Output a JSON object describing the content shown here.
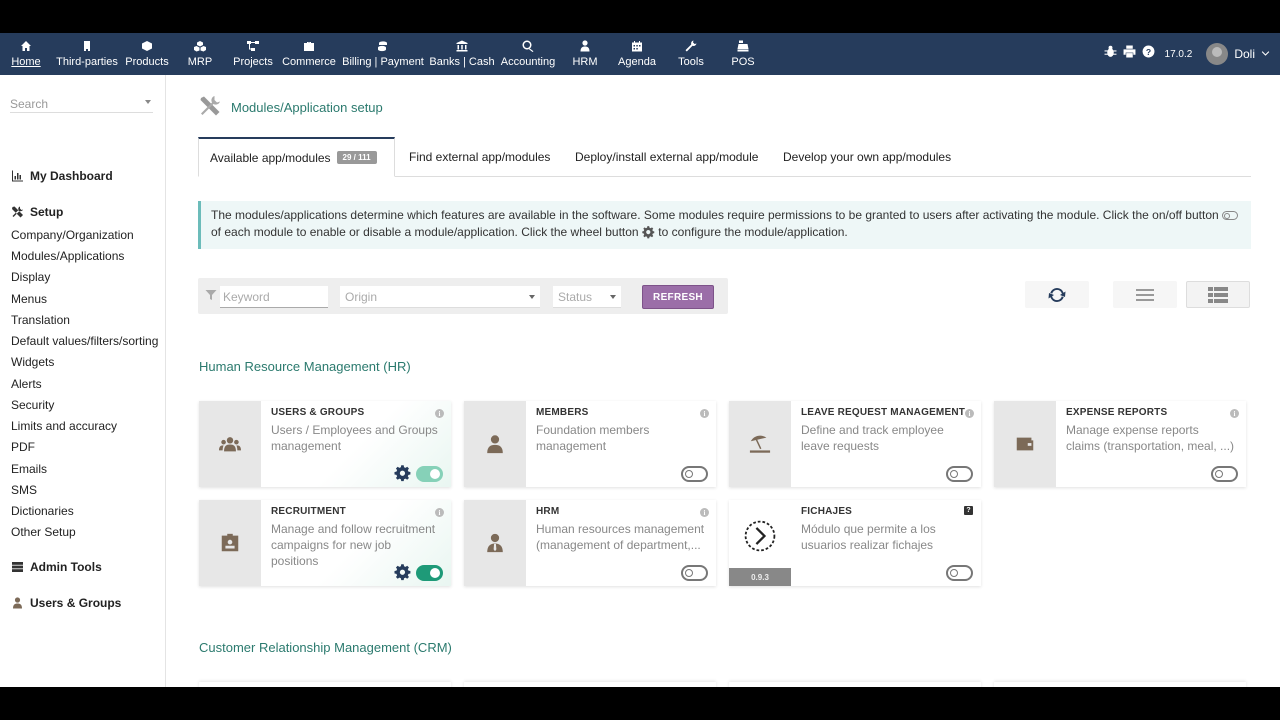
{
  "topbar": {
    "menus": [
      {
        "label": "Home",
        "icon": "home-icon"
      },
      {
        "label": "Third-parties",
        "icon": "building-icon"
      },
      {
        "label": "Products",
        "icon": "cube-icon"
      },
      {
        "label": "MRP",
        "icon": "cubes-icon"
      },
      {
        "label": "Projects",
        "icon": "project-diagram-icon"
      },
      {
        "label": "Commerce",
        "icon": "suitcase-icon"
      },
      {
        "label": "Billing | Payment",
        "icon": "coins-icon"
      },
      {
        "label": "Banks | Cash",
        "icon": "university-icon"
      },
      {
        "label": "Accounting",
        "icon": "search-dollar-icon"
      },
      {
        "label": "HRM",
        "icon": "user-tie-icon"
      },
      {
        "label": "Agenda",
        "icon": "calendar-icon"
      },
      {
        "label": "Tools",
        "icon": "wrench-icon"
      },
      {
        "label": "POS",
        "icon": "cash-register-icon"
      }
    ],
    "version": "17.0.2",
    "username": "Doli"
  },
  "sidebar": {
    "search_placeholder": "Search",
    "my_dashboard": "My Dashboard",
    "setup": "Setup",
    "setup_items": [
      "Company/Organization",
      "Modules/Applications",
      "Display",
      "Menus",
      "Translation",
      "Default values/filters/sorting",
      "Widgets",
      "Alerts",
      "Security",
      "Limits and accuracy",
      "PDF",
      "Emails",
      "SMS",
      "Dictionaries",
      "Other Setup"
    ],
    "admin_tools": "Admin Tools",
    "users_groups": "Users & Groups"
  },
  "main": {
    "title": "Modules/Application setup",
    "tabs": [
      {
        "label": "Available app/modules",
        "badge": "29 / 111"
      },
      {
        "label": "Find external app/modules"
      },
      {
        "label": "Deploy/install external app/module"
      },
      {
        "label": "Develop your own app/modules"
      }
    ],
    "info_part1": "The modules/applications determine which features are available in the software. Some modules require permissions to be granted to users after activating the module. Click the on/off button",
    "info_part2": "of each module to enable or disable a module/application. Click the wheel button",
    "info_part3": "to configure the module/application.",
    "filter": {
      "keyword_placeholder": "Keyword",
      "origin_placeholder": "Origin",
      "status_placeholder": "Status",
      "refresh_label": "REFRESH"
    },
    "sections": [
      {
        "title": "Human Resource Management (HR)",
        "modules": [
          {
            "title": "USERS & GROUPS",
            "desc": "Users / Employees and Groups management",
            "enabled": true,
            "icon": "users-icon"
          },
          {
            "title": "MEMBERS",
            "desc": "Foundation members management",
            "enabled": false,
            "icon": "user-icon"
          },
          {
            "title": "LEAVE REQUEST MANAGEMENT",
            "desc": "Define and track employee leave requests",
            "enabled": false,
            "icon": "umbrella-beach-icon"
          },
          {
            "title": "EXPENSE REPORTS",
            "desc": "Manage expense reports claims (transportation, meal, ...)",
            "enabled": false,
            "icon": "wallet-icon"
          },
          {
            "title": "RECRUITMENT",
            "desc": "Manage and follow recruitment campaigns for new job positions",
            "enabled": true,
            "icon": "id-badge-icon"
          },
          {
            "title": "HRM",
            "desc": "Human resources management (management of department,...",
            "enabled": false,
            "icon": "user-tie-icon"
          },
          {
            "title": "FICHAJES",
            "desc": "Módulo que permite a los usuarios realizar fichajes",
            "enabled": false,
            "icon": "clock-arrow-icon",
            "version": "0.9.3"
          }
        ]
      },
      {
        "title": "Customer Relationship Management (CRM)"
      }
    ]
  },
  "colors": {
    "topbar": "#263c5c",
    "accent_text": "#2b7a6e",
    "refresh_button": "#9b6ea8",
    "toggle_on": "#1e9a78",
    "gear": "#263c5c"
  }
}
